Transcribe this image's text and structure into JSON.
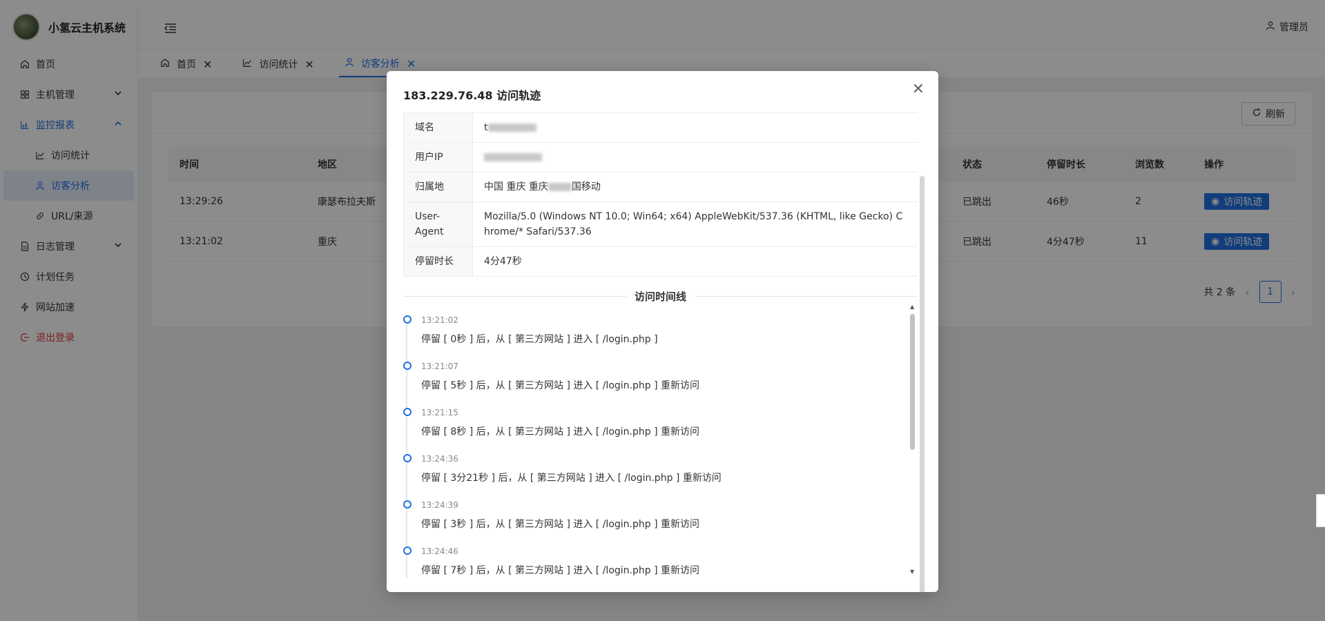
{
  "brand": {
    "name": "小氢云主机系统"
  },
  "sidebar": {
    "items": [
      {
        "label": "首页",
        "icon": "home-icon"
      },
      {
        "label": "主机管理",
        "icon": "grid-icon"
      },
      {
        "label": "监控报表",
        "icon": "chart-icon"
      },
      {
        "label": "访问统计",
        "icon": "line-chart-icon"
      },
      {
        "label": "访客分析",
        "icon": "user-icon"
      },
      {
        "label": "URL/来源",
        "icon": "link-icon"
      },
      {
        "label": "日志管理",
        "icon": "file-icon"
      },
      {
        "label": "计划任务",
        "icon": "clock-icon"
      },
      {
        "label": "网站加速",
        "icon": "bolt-icon"
      },
      {
        "label": "退出登录",
        "icon": "logout-icon"
      }
    ]
  },
  "header": {
    "user_label": "管理员"
  },
  "tabs": [
    {
      "label": "首页"
    },
    {
      "label": "访问统计"
    },
    {
      "label": "访客分析"
    }
  ],
  "toolbar": {
    "refresh_label": "刷新"
  },
  "table": {
    "headers": {
      "time": "时间",
      "region": "地区",
      "status": "状态",
      "stay": "停留时长",
      "views": "浏览数",
      "op": "操作"
    },
    "rows": [
      {
        "time": "13:29:26",
        "region": "康瑟布拉夫斯",
        "status": "已跳出",
        "stay": "46秒",
        "views": "2",
        "op": "访问轨迹"
      },
      {
        "time": "13:21:02",
        "region": "重庆",
        "status": "已跳出",
        "stay": "4分47秒",
        "views": "11",
        "op": "访问轨迹"
      }
    ]
  },
  "pagination": {
    "total": "共 2 条",
    "current": "1"
  },
  "modal": {
    "title": "183.229.76.48 访问轨迹",
    "details": [
      {
        "label": "域名",
        "value": "t"
      },
      {
        "label": "用户IP",
        "value": ""
      },
      {
        "label": "归属地",
        "value_a": "中国 重庆 重庆",
        "value_b": "国移动"
      },
      {
        "label": "User-Agent",
        "value": "Mozilla/5.0 (Windows NT 10.0; Win64; x64) AppleWebKit/537.36 (KHTML, like Gecko) Chrome/* Safari/537.36"
      },
      {
        "label": "停留时长",
        "value": "4分47秒"
      }
    ],
    "timeline_title": "访问时间线",
    "timeline": [
      {
        "time": "13:21:02",
        "text": "停留 [ 0秒 ] 后，从 [ 第三方网站 ] 进入 [ /login.php ]"
      },
      {
        "time": "13:21:07",
        "text": "停留 [ 5秒 ] 后，从 [ 第三方网站 ] 进入 [ /login.php ] 重新访问"
      },
      {
        "time": "13:21:15",
        "text": "停留 [ 8秒 ] 后，从 [ 第三方网站 ] 进入 [ /login.php ] 重新访问"
      },
      {
        "time": "13:24:36",
        "text": "停留 [ 3分21秒 ] 后，从 [ 第三方网站 ] 进入 [ /login.php ] 重新访问"
      },
      {
        "time": "13:24:39",
        "text": "停留 [ 3秒 ] 后，从 [ 第三方网站 ] 进入 [ /login.php ] 重新访问"
      },
      {
        "time": "13:24:46",
        "text": "停留 [ 7秒 ] 后，从 [ 第三方网站 ] 进入 [ /login.php ] 重新访问"
      }
    ]
  },
  "colors": {
    "accent": "#1f6fe0",
    "danger": "#e0393e",
    "overlay": "rgba(0,0,0,0.45)"
  }
}
